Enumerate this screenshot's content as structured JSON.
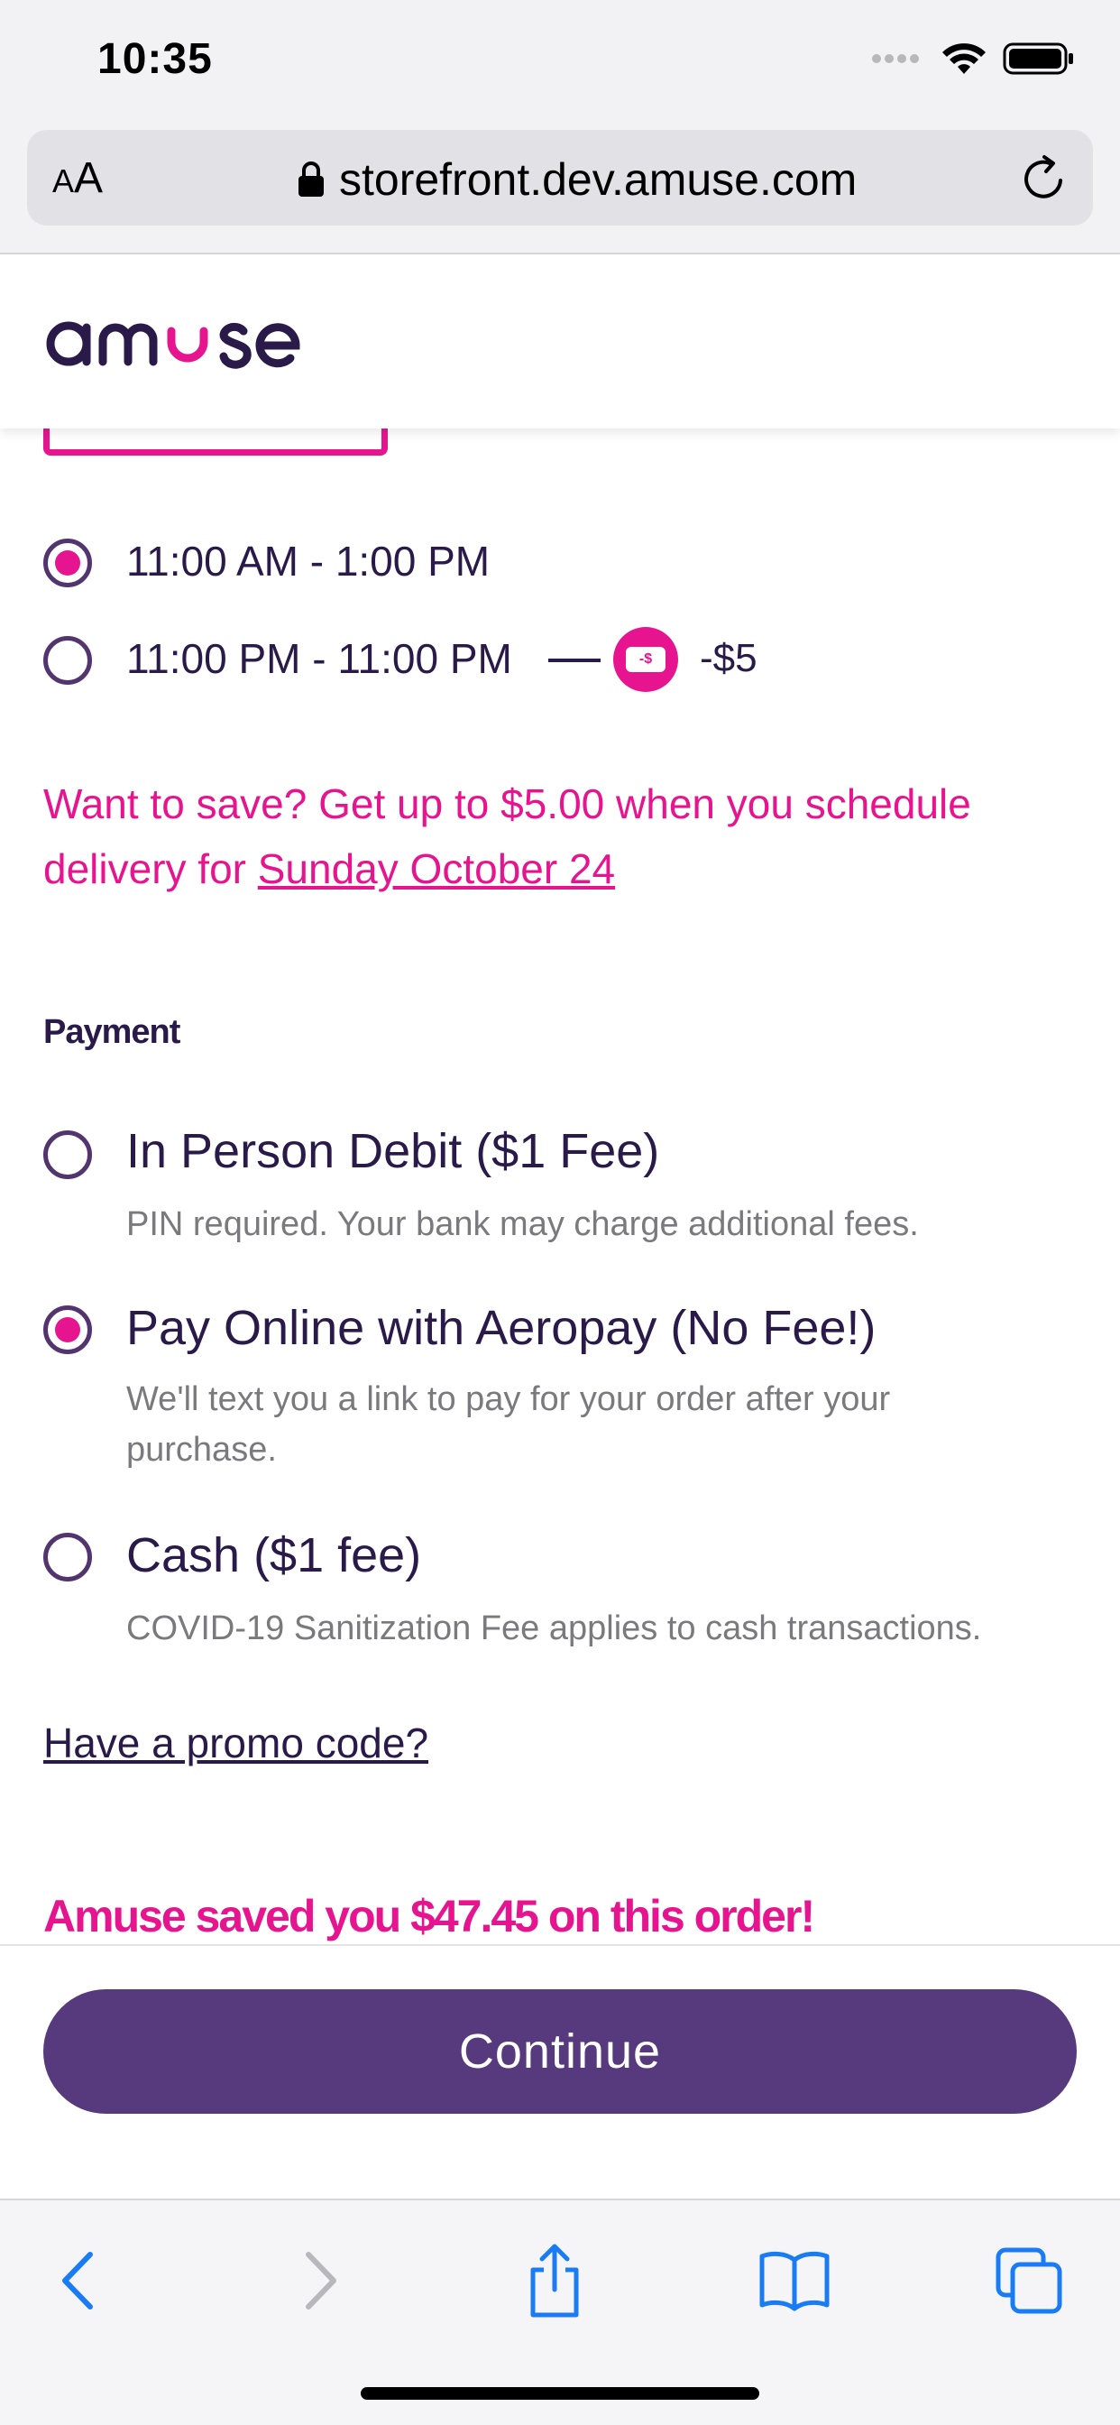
{
  "status_bar": {
    "time": "10:35"
  },
  "browser": {
    "text_size_label": "AA",
    "url": "storefront.dev.amuse.com"
  },
  "brand": {
    "logo_text": "amuse",
    "accent_color": "#e6158f",
    "primary_color": "#563a7d"
  },
  "delivery": {
    "time_slots": [
      {
        "label": "11:00 AM - 1:00 PM",
        "selected": true
      },
      {
        "label": "11:00 PM - 11:00 PM",
        "selected": false,
        "discount_badge": "-$",
        "discount": "-$5"
      }
    ],
    "save_message_prefix": "Want to save? Get up to $5.00 when you schedule delivery for ",
    "save_message_link": "Sunday October 24"
  },
  "payment": {
    "section_title": "Payment",
    "options": [
      {
        "title": "In Person Debit ($1 Fee)",
        "description": "PIN required. Your bank may charge additional fees.",
        "selected": false
      },
      {
        "title": "Pay Online with Aeropay (No Fee!)",
        "description": "We'll text you a link to pay for your order after your purchase.",
        "selected": true
      },
      {
        "title": "Cash ($1 fee)",
        "description": "COVID-19 Sanitization Fee applies to cash transactions.",
        "selected": false
      }
    ]
  },
  "promo_link": "Have a promo code?",
  "saved_message": "Amuse saved you $47.45 on this order!",
  "continue_label": "Continue",
  "toolbar": {
    "icons": [
      "back-icon",
      "forward-icon",
      "share-icon",
      "bookmarks-icon",
      "tabs-icon"
    ]
  }
}
